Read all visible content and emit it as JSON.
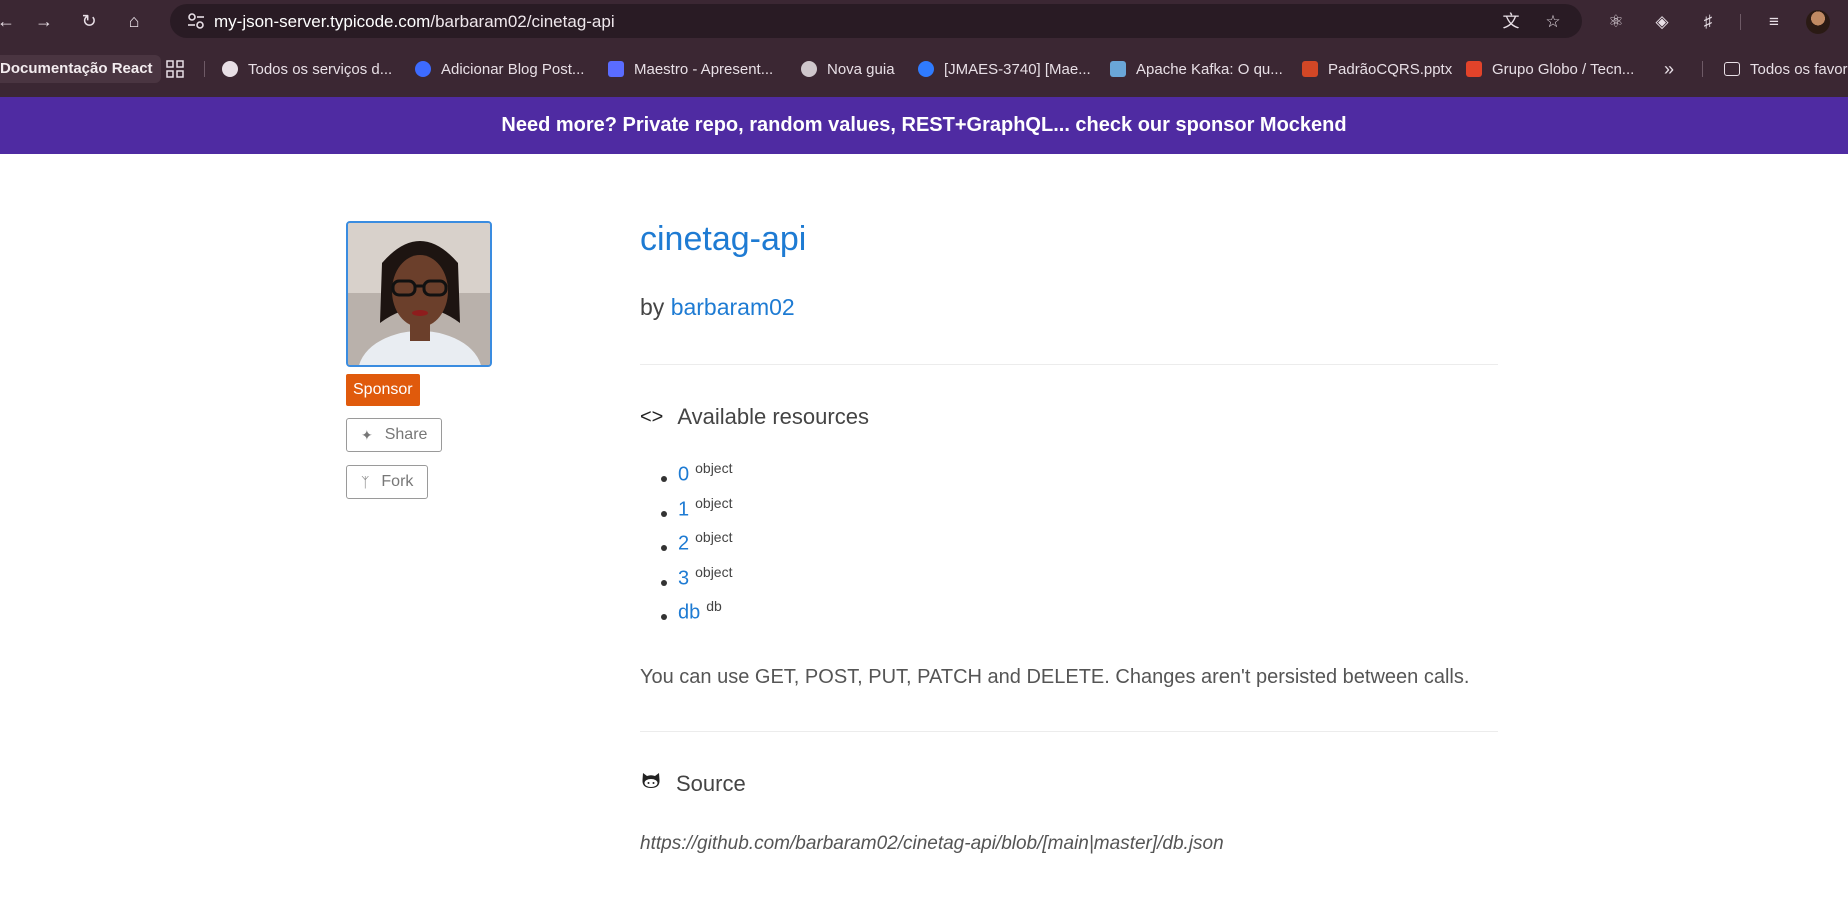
{
  "browser": {
    "url_host": "my-json-server.typicode.com",
    "url_path": "/barbaram02/cinetag-api",
    "bookmarks": [
      {
        "label": "Documentação React",
        "color": "#4a3541"
      },
      {
        "label": "Todos os serviços d...",
        "color": "#e8dfe6"
      },
      {
        "label": "Adicionar Blog Post...",
        "color": "#3d6bff"
      },
      {
        "label": "Maestro - Apresent...",
        "color": "#5a6cff"
      },
      {
        "label": "Nova guia",
        "color": "#cfc7cc"
      },
      {
        "label": "[JMAES-3740] [Mae...",
        "color": "#2f7bff"
      },
      {
        "label": "Apache Kafka: O qu...",
        "color": "#6aa6d8"
      },
      {
        "label": "PadrãoCQRS.pptx",
        "color": "#d24726"
      },
      {
        "label": "Grupo Globo / Tecn...",
        "color": "#e2432a"
      },
      {
        "label": "Todos os favoritos",
        "color": "#e8dfe6"
      }
    ]
  },
  "banner": {
    "text": "Need more? Private repo, random values, REST+GraphQL... check our sponsor Mockend"
  },
  "sidebar": {
    "sponsor_label": "Sponsor",
    "share_label": "Share",
    "fork_label": "Fork"
  },
  "repo": {
    "name": "cinetag-api",
    "by_prefix": "by",
    "owner": "barbaram02"
  },
  "resources": {
    "heading": "Available resources",
    "items": [
      {
        "name": "0",
        "type": "object"
      },
      {
        "name": "1",
        "type": "object"
      },
      {
        "name": "2",
        "type": "object"
      },
      {
        "name": "3",
        "type": "object"
      },
      {
        "name": "db",
        "type": "db"
      }
    ],
    "note": "You can use GET, POST, PUT, PATCH and DELETE. Changes aren't persisted between calls."
  },
  "source": {
    "heading": "Source",
    "url": "https://github.com/barbaram02/cinetag-api/blob/[main|master]/db.json"
  }
}
